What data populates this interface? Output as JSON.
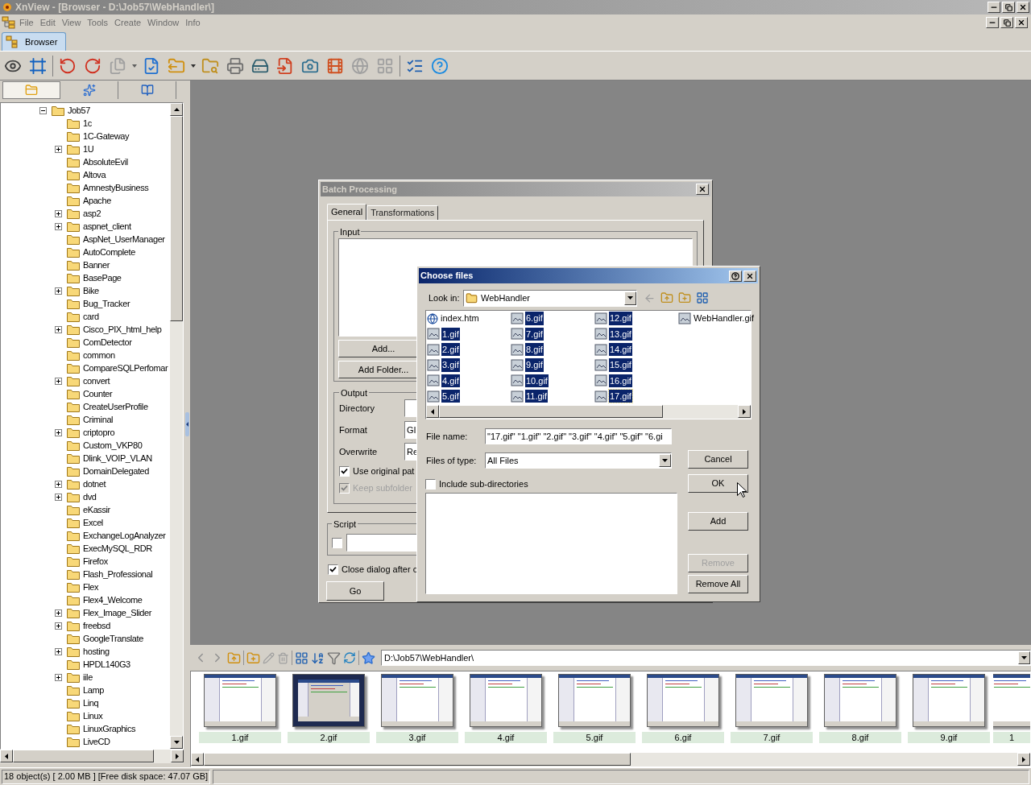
{
  "window": {
    "title": "XnView - [Browser - D:\\Job57\\WebHandler\\]"
  },
  "menu": [
    "File",
    "Edit",
    "View",
    "Tools",
    "Create",
    "Window",
    "Info"
  ],
  "tabs": [
    {
      "label": "Browser",
      "selected": true
    }
  ],
  "left_panel": {
    "tabs": [
      {
        "selected": true
      },
      {
        "selected": false
      },
      {
        "selected": false
      }
    ]
  },
  "tree": [
    {
      "label": "Job57",
      "expanded": true,
      "children": [
        {
          "label": "1c",
          "expandable": false
        },
        {
          "label": "1C-Gateway",
          "expandable": false
        },
        {
          "label": "1U",
          "expandable": true
        },
        {
          "label": "AbsoluteEvil",
          "expandable": false
        },
        {
          "label": "Altova",
          "expandable": false
        },
        {
          "label": "AmnestyBusiness",
          "expandable": false
        },
        {
          "label": "Apache",
          "expandable": false
        },
        {
          "label": "asp2",
          "expandable": true
        },
        {
          "label": "aspnet_client",
          "expandable": true
        },
        {
          "label": "AspNet_UserManager",
          "expandable": false
        },
        {
          "label": "AutoComplete",
          "expandable": false
        },
        {
          "label": "Banner",
          "expandable": false
        },
        {
          "label": "BasePage",
          "expandable": false
        },
        {
          "label": "Bike",
          "expandable": true
        },
        {
          "label": "Bug_Tracker",
          "expandable": false
        },
        {
          "label": "card",
          "expandable": false
        },
        {
          "label": "Cisco_PIX_html_help",
          "expandable": true
        },
        {
          "label": "ComDetector",
          "expandable": false
        },
        {
          "label": "common",
          "expandable": false
        },
        {
          "label": "CompareSQLPerfomar",
          "expandable": false
        },
        {
          "label": "convert",
          "expandable": true
        },
        {
          "label": "Counter",
          "expandable": false
        },
        {
          "label": "CreateUserProfile",
          "expandable": false
        },
        {
          "label": "Criminal",
          "expandable": false
        },
        {
          "label": "criptopro",
          "expandable": true
        },
        {
          "label": "Custom_VKP80",
          "expandable": false
        },
        {
          "label": "Dlink_VOIP_VLAN",
          "expandable": false
        },
        {
          "label": "DomainDelegated",
          "expandable": false
        },
        {
          "label": "dotnet",
          "expandable": true
        },
        {
          "label": "dvd",
          "expandable": true
        },
        {
          "label": "eKassir",
          "expandable": false
        },
        {
          "label": "Excel",
          "expandable": false
        },
        {
          "label": "ExchangeLogAnalyzer",
          "expandable": false
        },
        {
          "label": "ExecMySQL_RDR",
          "expandable": false
        },
        {
          "label": "Firefox",
          "expandable": false
        },
        {
          "label": "Flash_Professional",
          "expandable": false
        },
        {
          "label": "Flex",
          "expandable": false
        },
        {
          "label": "Flex4_Welcome",
          "expandable": false
        },
        {
          "label": "Flex_Image_Slider",
          "expandable": true
        },
        {
          "label": "freebsd",
          "expandable": true
        },
        {
          "label": "GoogleTranslate",
          "expandable": false
        },
        {
          "label": "hosting",
          "expandable": true
        },
        {
          "label": "HPDL140G3",
          "expandable": false
        },
        {
          "label": "iile",
          "expandable": true
        },
        {
          "label": "Lamp",
          "expandable": false
        },
        {
          "label": "Linq",
          "expandable": false
        },
        {
          "label": "Linux",
          "expandable": false
        },
        {
          "label": "LinuxGraphics",
          "expandable": false
        },
        {
          "label": "LiveCD",
          "expandable": false
        }
      ]
    }
  ],
  "batch_dialog": {
    "title": "Batch Processing",
    "tabs": [
      {
        "label": "General",
        "selected": true
      },
      {
        "label": "Transformations",
        "selected": false
      }
    ],
    "input": {
      "legend": "Input",
      "buttons": [
        "Add...",
        "Add Folder..."
      ]
    },
    "output": {
      "legend": "Output",
      "fields": [
        {
          "label": "Directory"
        },
        {
          "label": "Format",
          "value": "GI"
        },
        {
          "label": "Overwrite",
          "value": "Re"
        }
      ],
      "checkboxes": [
        {
          "label": "Use original pat",
          "checked": true,
          "disabled": false
        },
        {
          "label": "Keep subfolder",
          "checked": true,
          "disabled": true
        }
      ]
    },
    "script": {
      "legend": "Script",
      "checked": false
    },
    "close_after": {
      "label": "Close dialog after c",
      "checked": true
    },
    "go": "Go"
  },
  "choose_dialog": {
    "title": "Choose files",
    "look_in_label": "Look in:",
    "look_in": "WebHandler",
    "files": [
      {
        "name": "index.htm",
        "kind": "web",
        "selected": false,
        "focused": false
      },
      {
        "name": "1.gif",
        "kind": "image",
        "selected": true,
        "focused": false
      },
      {
        "name": "2.gif",
        "kind": "image",
        "selected": true,
        "focused": false
      },
      {
        "name": "3.gif",
        "kind": "image",
        "selected": true,
        "focused": false
      },
      {
        "name": "4.gif",
        "kind": "image",
        "selected": true,
        "focused": false
      },
      {
        "name": "5.gif",
        "kind": "image",
        "selected": true,
        "focused": false
      },
      {
        "name": "6.gif",
        "kind": "image",
        "selected": true,
        "focused": false
      },
      {
        "name": "7.gif",
        "kind": "image",
        "selected": true,
        "focused": false
      },
      {
        "name": "8.gif",
        "kind": "image",
        "selected": true,
        "focused": false
      },
      {
        "name": "9.gif",
        "kind": "image",
        "selected": true,
        "focused": false
      },
      {
        "name": "10.gif",
        "kind": "image",
        "selected": true,
        "focused": false
      },
      {
        "name": "11.gif",
        "kind": "image",
        "selected": true,
        "focused": false
      },
      {
        "name": "12.gif",
        "kind": "image",
        "selected": true,
        "focused": false
      },
      {
        "name": "13.gif",
        "kind": "image",
        "selected": true,
        "focused": false
      },
      {
        "name": "14.gif",
        "kind": "image",
        "selected": true,
        "focused": false
      },
      {
        "name": "15.gif",
        "kind": "image",
        "selected": true,
        "focused": false
      },
      {
        "name": "16.gif",
        "kind": "image",
        "selected": true,
        "focused": false
      },
      {
        "name": "17.gif",
        "kind": "image",
        "selected": true,
        "focused": true
      },
      {
        "name": "WebHandler.gif",
        "kind": "image",
        "selected": false,
        "focused": false
      }
    ],
    "file_name_label": "File name:",
    "file_name": "\"17.gif\" \"1.gif\" \"2.gif\" \"3.gif\" \"4.gif\" \"5.gif\" \"6.gi",
    "type_label": "Files of type:",
    "type": "All Files",
    "include_sub": {
      "label": "Include sub-directories",
      "checked": false
    },
    "buttons": [
      {
        "label": "Cancel",
        "disabled": false
      },
      {
        "label": "OK",
        "disabled": false
      },
      {
        "label": "Add",
        "disabled": false
      },
      {
        "label": "Remove",
        "disabled": true
      },
      {
        "label": "Remove All",
        "disabled": false
      }
    ]
  },
  "browser": {
    "path": "D:\\Job57\\WebHandler\\",
    "thumbnails": [
      {
        "label": "1.gif",
        "kind": "window"
      },
      {
        "label": "2.gif",
        "kind": "dialog"
      },
      {
        "label": "3.gif",
        "kind": "window"
      },
      {
        "label": "4.gif",
        "kind": "window"
      },
      {
        "label": "5.gif",
        "kind": "window"
      },
      {
        "label": "6.gif",
        "kind": "window"
      },
      {
        "label": "7.gif",
        "kind": "window"
      },
      {
        "label": "8.gif",
        "kind": "window"
      },
      {
        "label": "9.gif",
        "kind": "window"
      },
      {
        "label": "1",
        "kind": "window"
      }
    ]
  },
  "status_bar": [
    "18 object(s) [ 2.00 MB ] [Free disk space: 47.07 GB]"
  ]
}
